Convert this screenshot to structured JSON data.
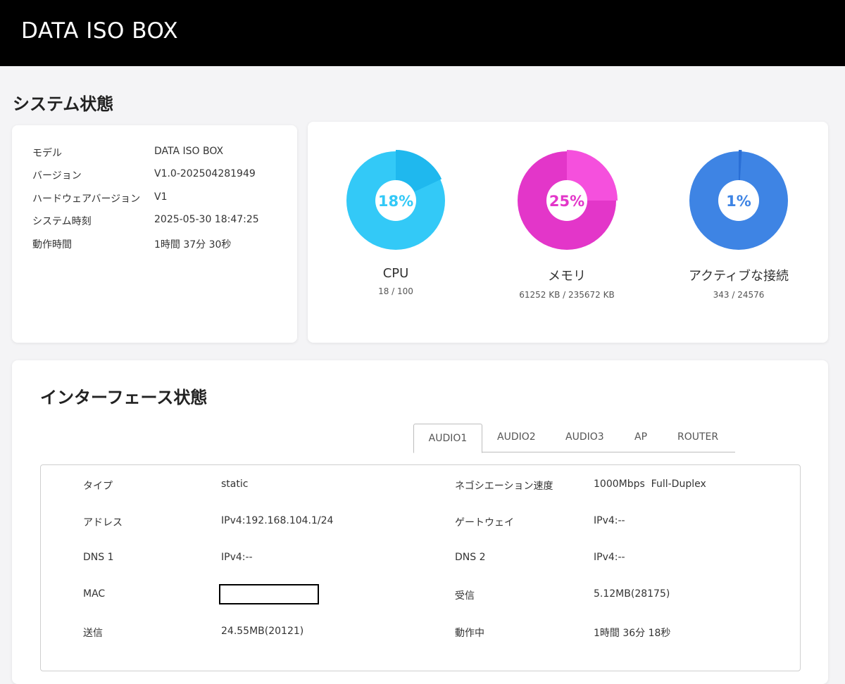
{
  "app": {
    "title": "DATA ISO BOX"
  },
  "system": {
    "title": "システム状態",
    "info": [
      {
        "label": "モデル",
        "value": "DATA ISO BOX"
      },
      {
        "label": "バージョン",
        "value": "V1.0-202504281949"
      },
      {
        "label": "ハードウェアバージョン",
        "value": "V1"
      },
      {
        "label": "システム時刻",
        "value": "2025-05-30 18:47:25"
      },
      {
        "label": "動作時間",
        "value": "1時間 37分 30秒"
      }
    ],
    "gauges": [
      {
        "name": "CPU",
        "percent_text": "18%",
        "fraction": 0.18,
        "detail": "18 / 100",
        "color": "#33c9f7",
        "hi": "#1fb8ee"
      },
      {
        "name": "メモリ",
        "percent_text": "25%",
        "fraction": 0.25,
        "detail": "61252 KB / 235672 KB",
        "color": "#e336c9",
        "hi": "#f550dd"
      },
      {
        "name": "アクティブな接続",
        "percent_text": "1%",
        "fraction": 0.01,
        "detail": "343 / 24576",
        "color": "#3e84e4",
        "hi": "#2a6fd6"
      }
    ]
  },
  "interfaces": {
    "title": "インターフェース状態",
    "tabs": [
      "AUDIO1",
      "AUDIO2",
      "AUDIO3",
      "AP",
      "ROUTER"
    ],
    "active_tab": "AUDIO1",
    "rows": [
      {
        "left_label": "タイプ",
        "left_value": "static",
        "right_label": "ネゴシエーション速度",
        "right_value": "1000Mbps  Full-Duplex"
      },
      {
        "left_label": "アドレス",
        "left_value": "IPv4:192.168.104.1/24",
        "right_label": "ゲートウェイ",
        "right_value": "IPv4:--"
      },
      {
        "left_label": "DNS 1",
        "left_value": "IPv4:--",
        "right_label": "DNS 2",
        "right_value": "IPv4:--"
      },
      {
        "left_label": "MAC",
        "left_value": "",
        "right_label": "受信",
        "right_value": "5.12MB(28175)"
      },
      {
        "left_label": "送信",
        "left_value": "24.55MB(20121)",
        "right_label": "動作中",
        "right_value": "1時間 36分 18秒"
      }
    ]
  }
}
